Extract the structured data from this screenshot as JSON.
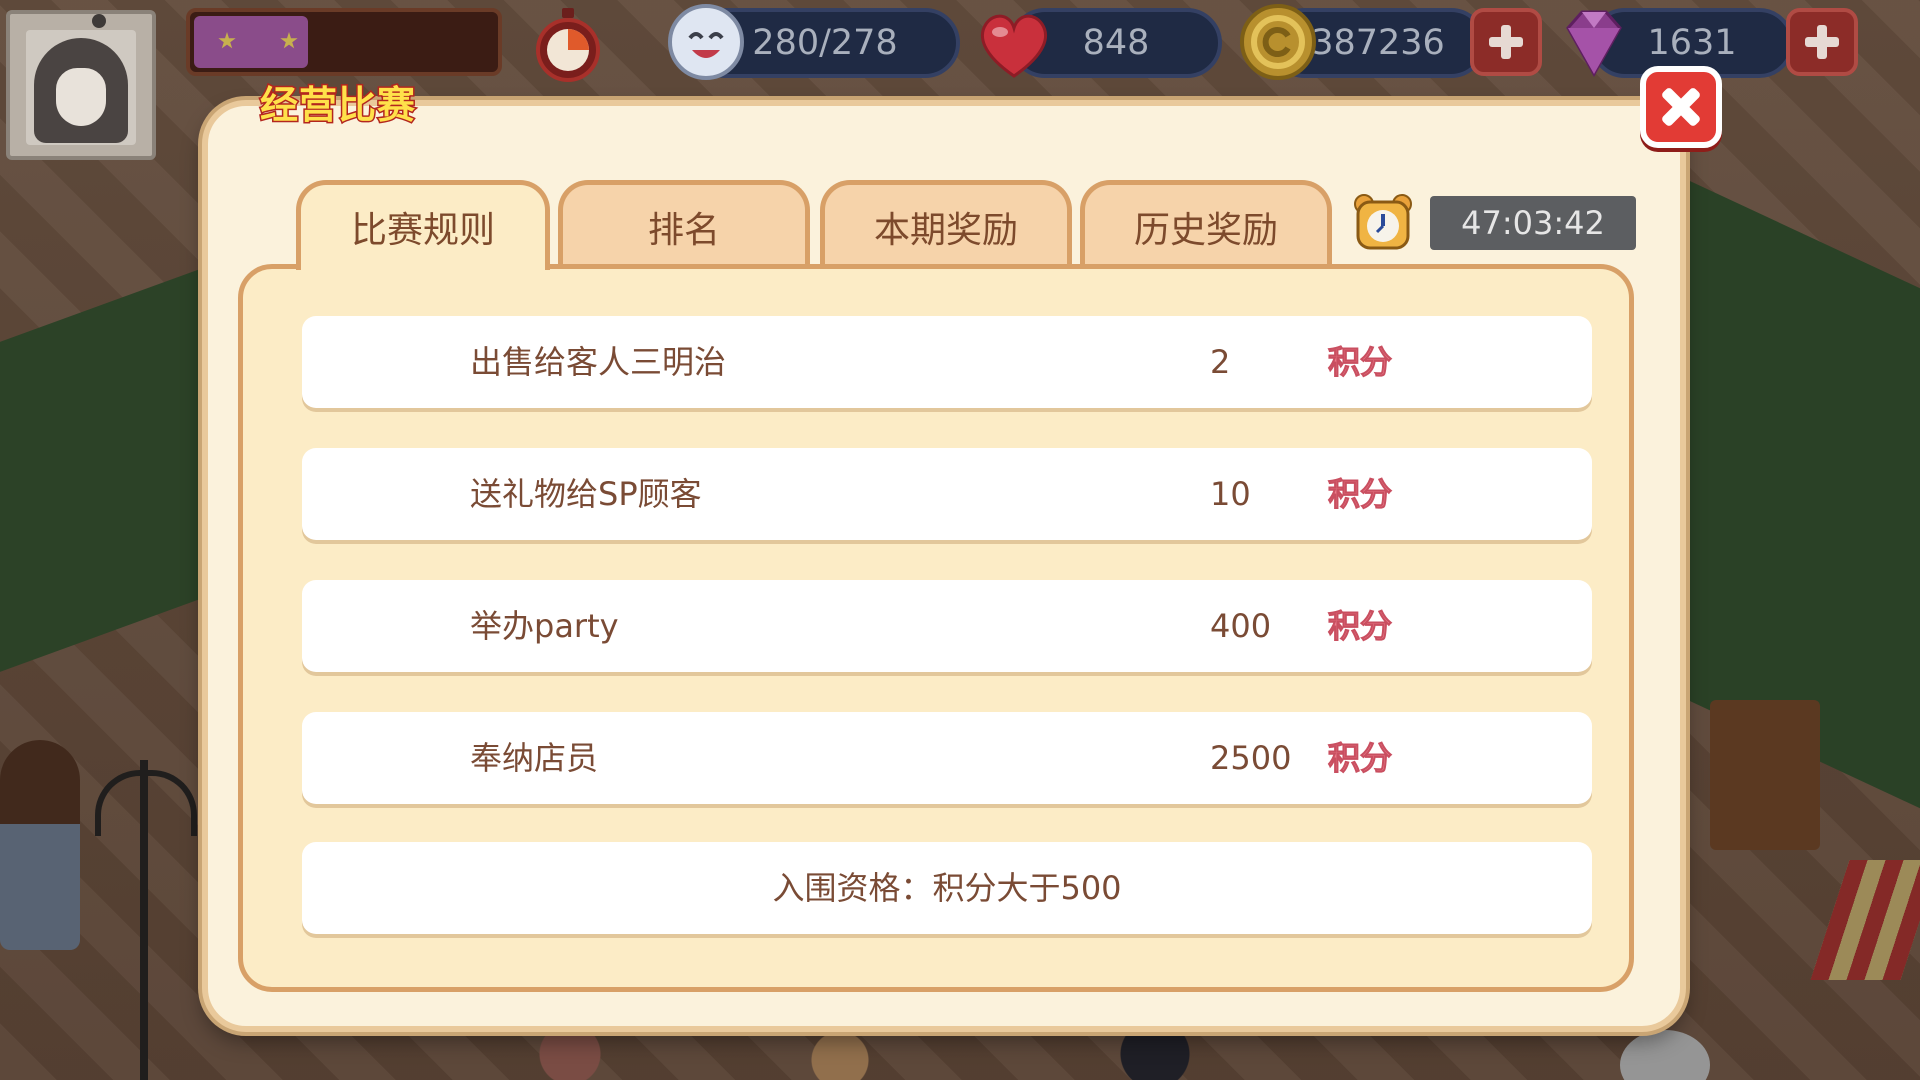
{
  "hud": {
    "energy": "280/278",
    "hearts": "848",
    "coins": "387236",
    "gems": "1631",
    "level_progress": 0.38
  },
  "modal": {
    "title": "经营比赛",
    "tabs": [
      {
        "label": "比赛规则",
        "active": true
      },
      {
        "label": "排名",
        "active": false
      },
      {
        "label": "本期奖励",
        "active": false
      },
      {
        "label": "历史奖励",
        "active": false
      }
    ],
    "timer": "47:03:42",
    "rules": [
      {
        "name": "出售给客人三明治",
        "points": "2",
        "unit": "积分"
      },
      {
        "name": "送礼物给SP顾客",
        "points": "10",
        "unit": "积分"
      },
      {
        "name": "举办party",
        "points": "400",
        "unit": "积分"
      },
      {
        "name": "奉纳店员",
        "points": "2500",
        "unit": "积分"
      }
    ],
    "qualification": "入围资格：积分大于500"
  },
  "colors": {
    "accent_pink": "#ec7d8c",
    "close_red": "#e23b35",
    "tab_border": "#d8a067",
    "panel_bg": "#fcecc6"
  },
  "icons": [
    "avatar",
    "stopwatch-icon",
    "smiley-energy-icon",
    "heart-icon",
    "coin-icon",
    "gem-icon",
    "plus-icon",
    "close-icon",
    "alarm-clock-icon"
  ]
}
